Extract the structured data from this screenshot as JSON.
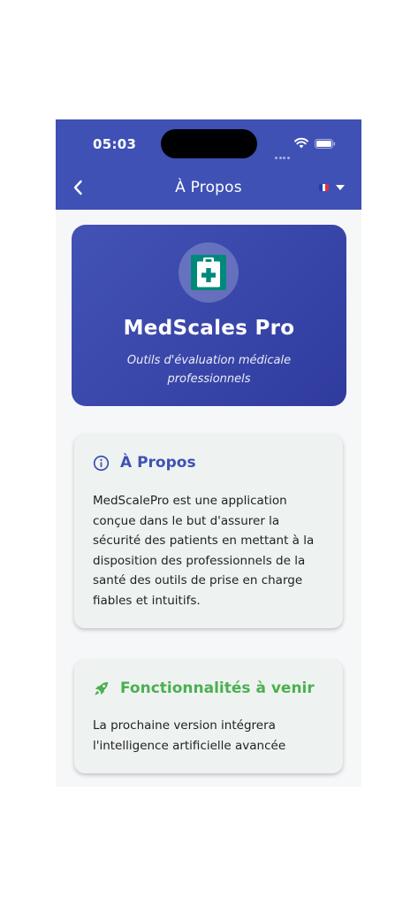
{
  "status_bar": {
    "time": "05:03"
  },
  "app_bar": {
    "title": "À Propos",
    "language": "fr"
  },
  "hero": {
    "app_name": "MedScales Pro",
    "tagline": "Outils d'évaluation médicale professionnels",
    "icon": "medical-clipboard-icon"
  },
  "about_card": {
    "icon": "info-icon",
    "title": "À Propos",
    "body": "MedScalePro est une application conçue dans le but d'assurer la sécurité des patients en mettant à la disposition des professionnels de la santé des outils de prise en charge fiables et intuitifs."
  },
  "future_card": {
    "icon": "rocket-icon",
    "title": "Fonctionnalités à venir",
    "body": "La prochaine version intégrera l'intelligence artificielle avancée"
  },
  "colors": {
    "primary": "#3f51b5",
    "accent_green": "#4caf50",
    "card_background": "#eef3f1",
    "icon_teal": "#00897b"
  }
}
